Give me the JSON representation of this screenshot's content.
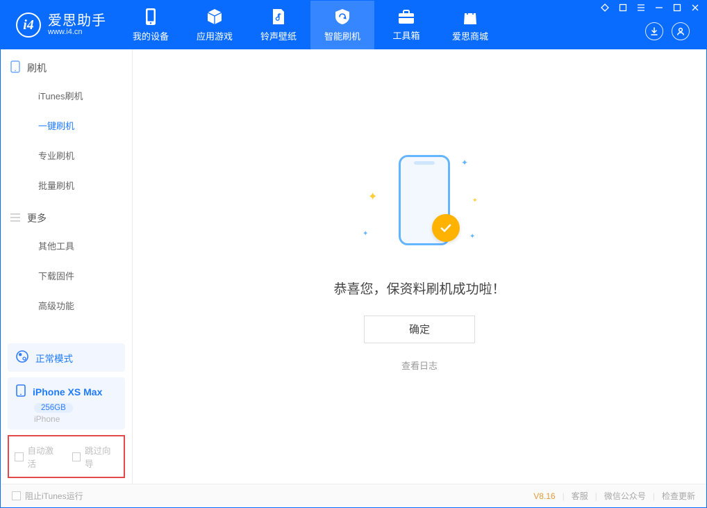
{
  "app": {
    "name": "爱思助手",
    "domain": "www.i4.cn"
  },
  "topnav": {
    "my_device": "我的设备",
    "apps": "应用游戏",
    "ringtones": "铃声壁纸",
    "flash": "智能刷机",
    "toolbox": "工具箱",
    "store": "爱思商城"
  },
  "sidebar": {
    "section_flash": "刷机",
    "items_flash": {
      "itunes": "iTunes刷机",
      "onekey": "一键刷机",
      "pro": "专业刷机",
      "batch": "批量刷机"
    },
    "section_more": "更多",
    "items_more": {
      "other_tools": "其他工具",
      "download_fw": "下载固件",
      "advanced": "高级功能"
    }
  },
  "mode_card": {
    "label": "正常模式"
  },
  "device_card": {
    "name": "iPhone XS Max",
    "storage": "256GB",
    "type": "iPhone"
  },
  "options": {
    "auto_activate": "自动激活",
    "skip_guide": "跳过向导"
  },
  "main": {
    "success_title": "恭喜您，保资料刷机成功啦！",
    "ok_label": "确定",
    "view_log": "查看日志"
  },
  "statusbar": {
    "block_itunes": "阻止iTunes运行",
    "version": "V8.16",
    "support": "客服",
    "wechat": "微信公众号",
    "check_update": "检查更新"
  }
}
